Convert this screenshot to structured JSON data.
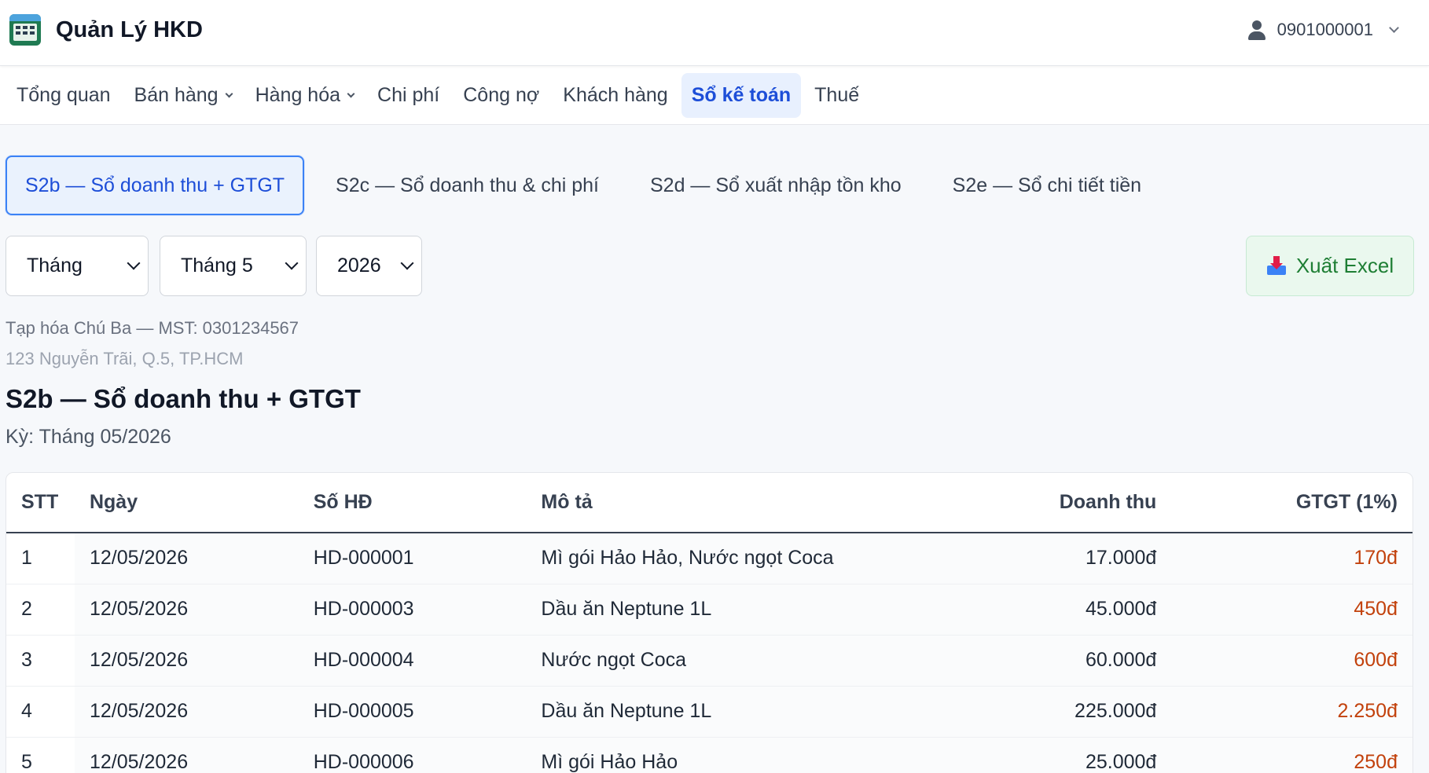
{
  "app": {
    "title": "Quản Lý HKD",
    "logo_icon": "ledger-app-icon"
  },
  "user": {
    "phone": "0901000001"
  },
  "nav": {
    "items": [
      {
        "label": "Tổng quan",
        "has_dropdown": false
      },
      {
        "label": "Bán hàng",
        "has_dropdown": true
      },
      {
        "label": "Hàng hóa",
        "has_dropdown": true
      },
      {
        "label": "Chi phí",
        "has_dropdown": false
      },
      {
        "label": "Công nợ",
        "has_dropdown": false
      },
      {
        "label": "Khách hàng",
        "has_dropdown": false
      },
      {
        "label": "Sổ kế toán",
        "has_dropdown": false,
        "active": true
      },
      {
        "label": "Thuế",
        "has_dropdown": false
      }
    ]
  },
  "subtabs": [
    {
      "label": "S2b — Sổ doanh thu + GTGT",
      "active": true
    },
    {
      "label": "S2c — Sổ doanh thu & chi phí",
      "active": false
    },
    {
      "label": "S2d — Sổ xuất nhập tồn kho",
      "active": false
    },
    {
      "label": "S2e — Sổ chi tiết tiền",
      "active": false
    }
  ],
  "filters": {
    "period_type": "Tháng",
    "month": "Tháng 5",
    "year": "2026"
  },
  "export": {
    "label": "Xuất Excel",
    "icon": "download-tray-icon"
  },
  "business": {
    "name_line": "Tạp hóa Chú Ba — MST: 0301234567",
    "address": "123 Nguyễn Trãi, Q.5, TP.HCM"
  },
  "report": {
    "title": "S2b — Sổ doanh thu + GTGT",
    "period": "Kỳ: Tháng 05/2026"
  },
  "table": {
    "headers": [
      "STT",
      "Ngày",
      "Số HĐ",
      "Mô tả",
      "Doanh thu",
      "GTGT (1%)"
    ],
    "rows": [
      [
        "1",
        "12/05/2026",
        "HD-000001",
        "Mì gói Hảo Hảo, Nước ngọt Coca",
        "17.000đ",
        "170đ"
      ],
      [
        "2",
        "12/05/2026",
        "HD-000003",
        "Dầu ăn Neptune 1L",
        "45.000đ",
        "450đ"
      ],
      [
        "3",
        "12/05/2026",
        "HD-000004",
        "Nước ngọt Coca",
        "60.000đ",
        "600đ"
      ],
      [
        "4",
        "12/05/2026",
        "HD-000005",
        "Dầu ăn Neptune 1L",
        "225.000đ",
        "2.250đ"
      ],
      [
        "5",
        "12/05/2026",
        "HD-000006",
        "Mì gói Hảo Hảo",
        "25.000đ",
        "250đ"
      ]
    ]
  },
  "colors": {
    "accent": "#1d4ed8",
    "vat": "#c2410c",
    "export_text": "#1e7e34"
  }
}
